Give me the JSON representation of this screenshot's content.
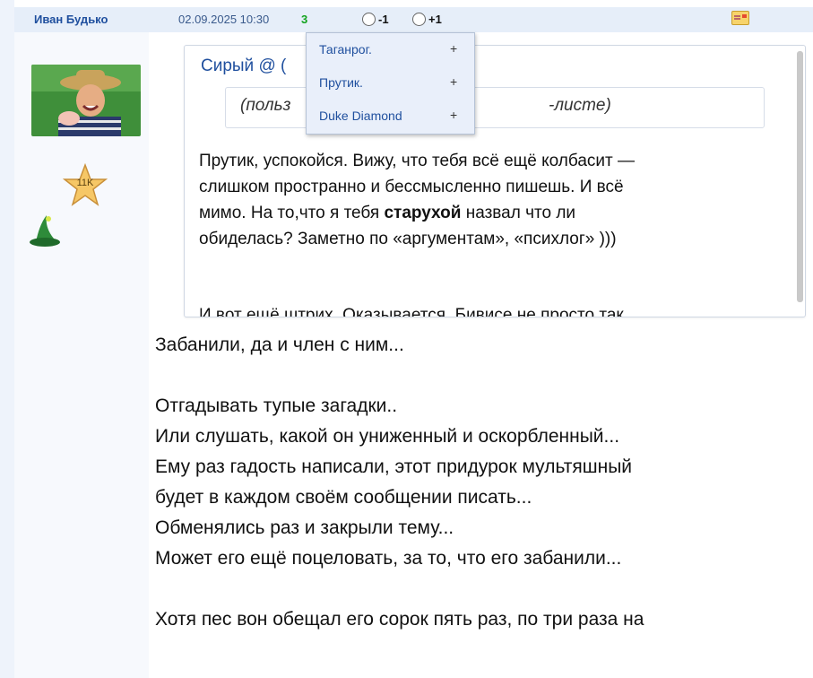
{
  "post": {
    "author": "Иван Будько",
    "date": "02.09.2025 10:30",
    "score": "3",
    "vote_minus": "-1",
    "vote_plus": "+1",
    "avatar_badge": "11K"
  },
  "popup": {
    "items": [
      {
        "name": "Таганрог.",
        "plus": "+"
      },
      {
        "name": "Прутик.",
        "plus": "+"
      },
      {
        "name": "Duke Diamond",
        "plus": "+"
      }
    ]
  },
  "quote": {
    "author": "Сирый @ (",
    "note_left": "(польз",
    "note_right": "-листе)",
    "lines": [
      "Прутик, успокойся. Вижу, что тебя всё ещё колбасит —",
      "слишком пространно и бессмысленно пишешь. И всё",
      "мимо. На то,что я тебя ",
      "старухой",
      " назвал что ли",
      "обиделась? Заметно по «аргументам», «психлог» )))"
    ],
    "cut_line": "И вот ещё штрих. Оказывается, Бивисе не просто так"
  },
  "body": {
    "lines": [
      "Забанили, да и член с ним...",
      "",
      "Отгадывать тупые загадки..",
      "Или слушать, какой он униженный и оскорбленный...",
      "Ему раз гадость написали, этот придурок мультяшный",
      "будет в каждом своём сообщении писать...",
      "Обменялись раз и закрыли тему...",
      "Может его ещё поцеловать, за то, что его забанили...",
      "",
      "Хотя пес вон обещал его сорок пять раз, по три раза на"
    ]
  },
  "icons": {
    "message": "message-icon",
    "star": "star-badge-icon",
    "hat": "wizard-hat-icon"
  }
}
